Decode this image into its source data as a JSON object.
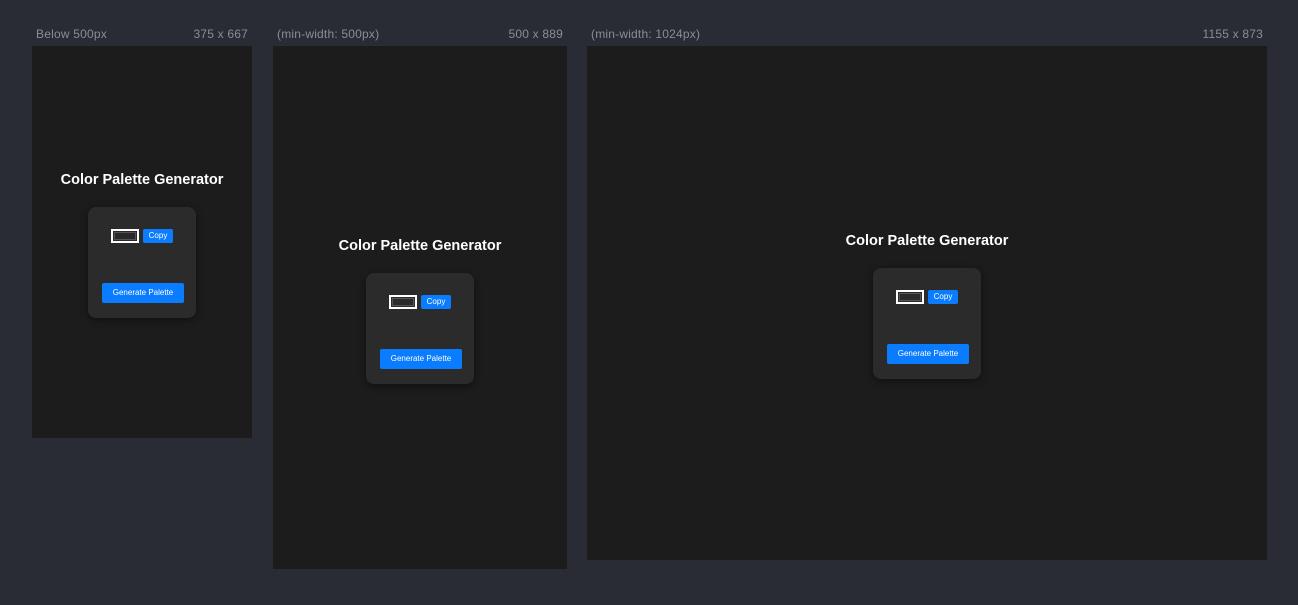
{
  "viewports": [
    {
      "label": "Below 500px",
      "size": "375 x 667"
    },
    {
      "label": "(min-width: 500px)",
      "size": "500 x 889"
    },
    {
      "label": "(min-width: 1024px)",
      "size": "1155 x 873"
    }
  ],
  "app": {
    "title": "Color Palette Generator",
    "copy_label": "Copy",
    "generate_label": "Generate Palette"
  },
  "colors": {
    "page_background": "#2a2c35",
    "viewport_background": "#1c1c1c",
    "card_background": "#2b2b2b",
    "accent": "#0a7cff",
    "title_text": "#ffffff",
    "caption_text": "#8a8d96"
  }
}
